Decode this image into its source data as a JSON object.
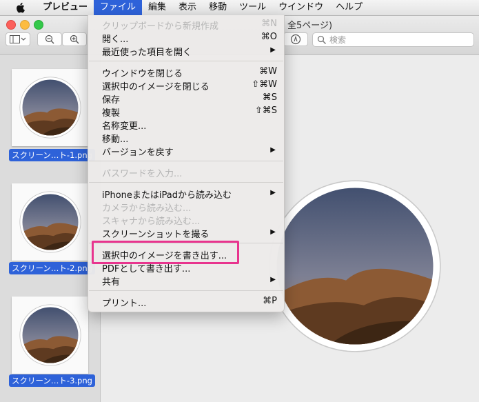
{
  "menubar": {
    "apple_icon": "apple-logo-icon",
    "app_name": "プレビュー",
    "items": [
      "ファイル",
      "編集",
      "表示",
      "移動",
      "ツール",
      "ウインドウ",
      "ヘルプ"
    ]
  },
  "window": {
    "title_fragment": "全5ページ)",
    "search_placeholder": "検索"
  },
  "sidebar": {
    "thumbnails": [
      {
        "label": "スクリーン…ト-1.png"
      },
      {
        "label": "スクリーン…ト-2.png"
      },
      {
        "label": "スクリーン…ト-3.png"
      }
    ]
  },
  "file_menu": {
    "items": [
      {
        "label": "クリップボードから新規作成",
        "shortcut": "⌘N",
        "enabled": false
      },
      {
        "label": "開く...",
        "shortcut": "⌘O",
        "enabled": true
      },
      {
        "label": "最近使った項目を開く",
        "submenu": true,
        "enabled": true
      },
      {
        "label": "ウインドウを閉じる",
        "shortcut": "⌘W",
        "enabled": true
      },
      {
        "label": "選択中のイメージを閉じる",
        "shortcut": "⇧⌘W",
        "enabled": true
      },
      {
        "label": "保存",
        "shortcut": "⌘S",
        "enabled": true
      },
      {
        "label": "複製",
        "shortcut": "⇧⌘S",
        "enabled": true
      },
      {
        "label": "名称変更...",
        "enabled": true
      },
      {
        "label": "移動...",
        "enabled": true
      },
      {
        "label": "バージョンを戻す",
        "submenu": true,
        "enabled": true
      },
      {
        "label": "パスワードを入力...",
        "enabled": false
      },
      {
        "label": "iPhoneまたはiPadから読み込む",
        "submenu": true,
        "enabled": true
      },
      {
        "label": "カメラから読み込む...",
        "enabled": false
      },
      {
        "label": "スキャナから読み込む...",
        "enabled": false
      },
      {
        "label": "スクリーンショットを撮る",
        "submenu": true,
        "enabled": true
      },
      {
        "label": "選択中のイメージを書き出す...",
        "enabled": true,
        "highlighted": true
      },
      {
        "label": "PDFとして書き出す...",
        "enabled": true
      },
      {
        "label": "共有",
        "submenu": true,
        "enabled": true
      },
      {
        "label": "プリント...",
        "shortcut": "⌘P",
        "enabled": true
      }
    ]
  },
  "colors": {
    "accent": "#2e62d9",
    "highlight_frame": "#e8348e"
  }
}
